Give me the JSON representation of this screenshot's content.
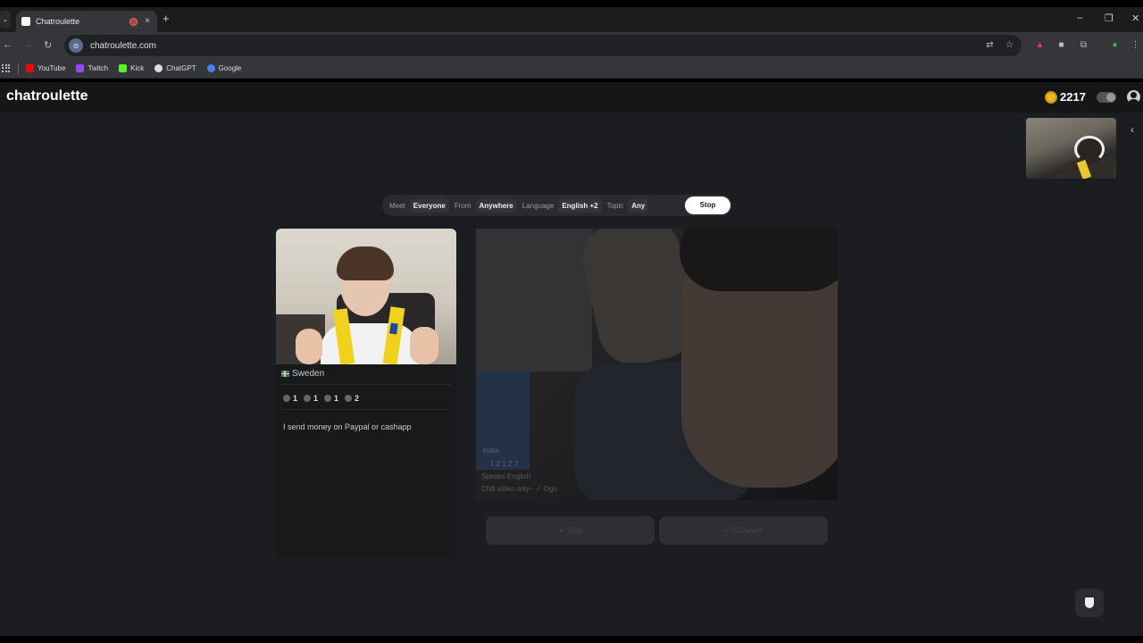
{
  "browser": {
    "tab_title": "Chatroulette",
    "new_tab": "+",
    "tab_close": "×",
    "url": "chatroulette.com",
    "bookmarks": [
      {
        "label": "YouTube",
        "color": "#ff0000"
      },
      {
        "label": "Twitch",
        "color": "#9146ff"
      },
      {
        "label": "Kick",
        "color": "#53fc18"
      },
      {
        "label": "ChatGPT",
        "color": "#dddddd"
      },
      {
        "label": "Google",
        "color": "#4285f4"
      }
    ],
    "window_controls": {
      "minimize": "–",
      "restore": "❐",
      "close": "✕"
    }
  },
  "app": {
    "logo": "chatroulette",
    "coins": "2217",
    "accent": "#e8b923"
  },
  "filters": {
    "meet_label": "Meet",
    "meet_value": "Everyone",
    "from_label": "From",
    "from_value": "Anywhere",
    "language_label": "Language",
    "language_value": "English +2",
    "topic_label": "Topic",
    "topic_value": "Any",
    "stop_label": "Stop"
  },
  "profile_card": {
    "country": "Sweden",
    "stats": [
      "1",
      "1",
      "1",
      "2"
    ],
    "bio": "I send money on Paypal or cashapp"
  },
  "next_match": {
    "country": "India",
    "stats_line": "1  2  1  2  7",
    "languages": "Speaks English",
    "bio": "Chill video only~ ✓ Ogn",
    "skip_label": "✕ Skip",
    "connect_label": "✓ Connect"
  }
}
